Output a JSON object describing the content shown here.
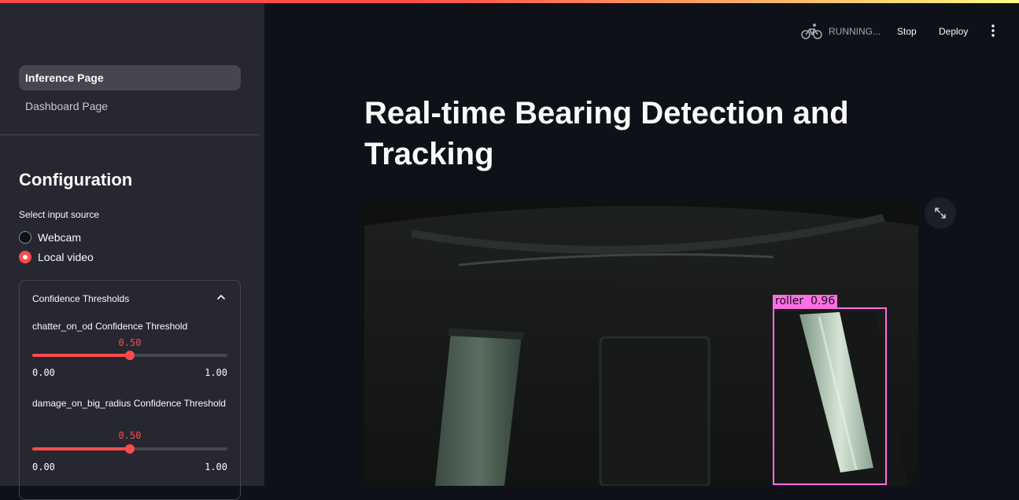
{
  "sidebar": {
    "nav": [
      {
        "label": "Inference Page",
        "active": true
      },
      {
        "label": "Dashboard Page",
        "active": false
      }
    ],
    "config_title": "Configuration",
    "input_source": {
      "label": "Select input source",
      "options": [
        "Webcam",
        "Local video"
      ],
      "selected": "Local video"
    },
    "expander": {
      "title": "Confidence Thresholds",
      "expanded": true,
      "sliders": [
        {
          "label": "chatter_on_od Confidence Threshold",
          "value": "0.50",
          "value_fraction": 0.5,
          "min": "0.00",
          "max": "1.00"
        },
        {
          "label": "damage_on_big_radius Confidence Threshold",
          "value": "0.50",
          "value_fraction": 0.5,
          "min": "0.00",
          "max": "1.00"
        }
      ]
    }
  },
  "header": {
    "status": "RUNNING...",
    "stop_label": "Stop",
    "deploy_label": "Deploy",
    "status_icon": "bicycle-icon",
    "menu_icon": "kebab-menu-icon"
  },
  "main": {
    "title": "Real-time Bearing Detection and Tracking",
    "video": {
      "detection": {
        "label": "roller",
        "score": "0.96",
        "label_text": "roller  0.96"
      }
    },
    "fullscreen_icon": "fullscreen-icon"
  },
  "colors": {
    "accent": "#ff4b4b",
    "sidebar_bg": "#262730",
    "main_bg": "#0e1117",
    "bbox": "#ff6ee6"
  }
}
